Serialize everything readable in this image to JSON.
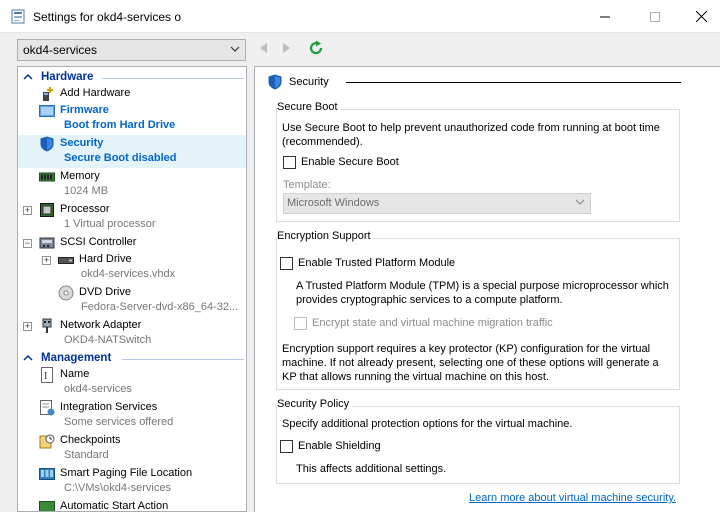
{
  "window": {
    "title": "Settings for okd4-services o",
    "min_glyph": "—",
    "max_glyph": "☐",
    "close_glyph": "✕"
  },
  "toolbar": {
    "vm_selected": "okd4-services",
    "back_icon": "back-arrow-icon",
    "forward_icon": "forward-arrow-icon",
    "refresh_icon": "refresh-icon"
  },
  "sidebar": {
    "hardware_label": "Hardware",
    "management_label": "Management",
    "hardware_items": [
      {
        "label": "Add Hardware",
        "sub": "",
        "icon": "add-hardware-icon"
      },
      {
        "label": "Firmware",
        "sub": "Boot from Hard Drive",
        "icon": "firmware-icon"
      },
      {
        "label": "Security",
        "sub": "Secure Boot disabled",
        "icon": "shield-icon"
      },
      {
        "label": "Memory",
        "sub": "1024 MB",
        "icon": "memory-icon"
      },
      {
        "label": "Processor",
        "sub": "1 Virtual processor",
        "icon": "processor-icon"
      },
      {
        "label": "SCSI Controller",
        "sub": "",
        "icon": "scsi-icon"
      },
      {
        "label": "Hard Drive",
        "sub": "okd4-services.vhdx",
        "icon": "hard-drive-icon"
      },
      {
        "label": "DVD Drive",
        "sub": "Fedora-Server-dvd-x86_64-32...",
        "icon": "dvd-icon"
      },
      {
        "label": "Network Adapter",
        "sub": "OKD4-NATSwitch",
        "icon": "network-adapter-icon"
      }
    ],
    "management_items": [
      {
        "label": "Name",
        "sub": "okd4-services",
        "icon": "name-icon"
      },
      {
        "label": "Integration Services",
        "sub": "Some services offered",
        "icon": "integration-icon"
      },
      {
        "label": "Checkpoints",
        "sub": "Standard",
        "icon": "checkpoints-icon"
      },
      {
        "label": "Smart Paging File Location",
        "sub": "C:\\VMs\\okd4-services",
        "icon": "paging-icon"
      },
      {
        "label": "Automatic Start Action",
        "sub": "",
        "icon": "start-action-icon"
      }
    ]
  },
  "main": {
    "heading": "Security",
    "secure_boot": {
      "title": "Secure Boot",
      "description": "Use Secure Boot to help prevent unauthorized code from running at boot time (recommended).",
      "enable_label": "Enable Secure Boot",
      "template_label": "Template:",
      "template_value": "Microsoft Windows"
    },
    "encryption": {
      "title": "Encryption Support",
      "tpm_label": "Enable Trusted Platform Module",
      "tpm_description": "A Trusted Platform Module (TPM) is a special purpose microprocessor which provides cryptographic services to a compute platform.",
      "encrypt_label": "Encrypt state and virtual machine migration traffic",
      "kp_description": "Encryption support requires a key protector (KP) configuration for the virtual machine. If not already present, selecting one of these options will generate a KP that allows running the virtual machine on this host."
    },
    "policy": {
      "title": "Security Policy",
      "description": "Specify additional protection options for the virtual machine.",
      "shielding_label": "Enable Shielding",
      "shielding_note": "This affects additional settings."
    },
    "learn_more": "Learn more about virtual machine security."
  },
  "colors": {
    "accent": "#0066cc",
    "section_header": "#003399",
    "selected_bg": "#e5f3fb"
  }
}
